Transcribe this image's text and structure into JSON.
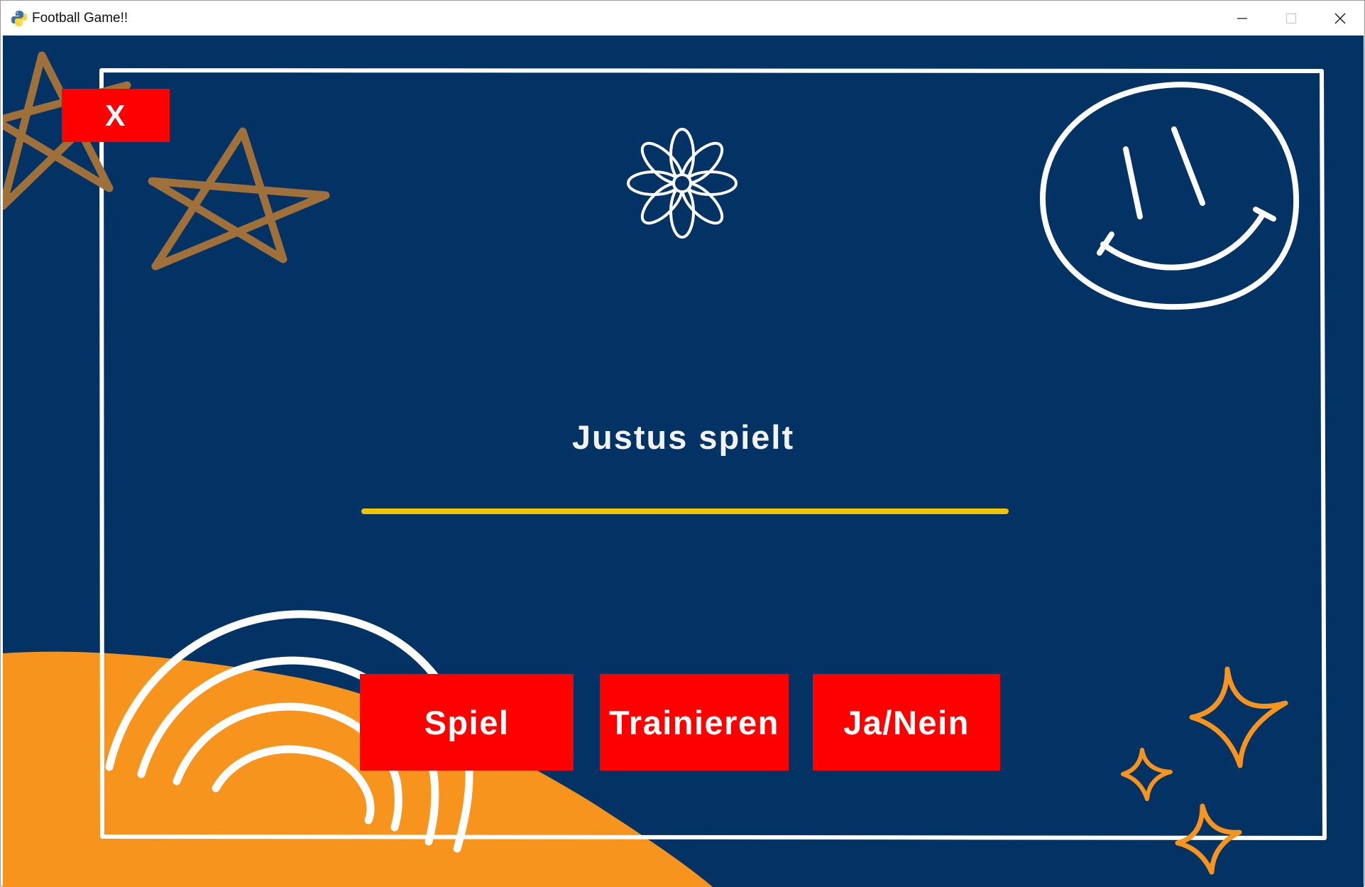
{
  "window": {
    "title": "Football Game!!",
    "app_icon": "python-icon",
    "controls": {
      "minimize": "minimize-icon",
      "maximize": "maximize-icon",
      "close": "close-icon"
    }
  },
  "game": {
    "close_label": "X",
    "player_text": "Justus spielt",
    "progress": 1.0,
    "buttons": {
      "play": "Spiel",
      "train": "Trainieren",
      "yes_no": "Ja/Nein"
    },
    "decorations": [
      "star-icon",
      "star-icon",
      "flower-icon",
      "smiley-icon",
      "rainbow-icon",
      "sparkle-icon",
      "sparkle-icon",
      "sparkle-icon"
    ]
  },
  "colors": {
    "background": "#033264",
    "accent_red": "#ff0000",
    "progress_yellow": "#f2c300",
    "orange": "#f7941e",
    "star_brown": "#a0703a",
    "outline_white": "#ffffff"
  }
}
